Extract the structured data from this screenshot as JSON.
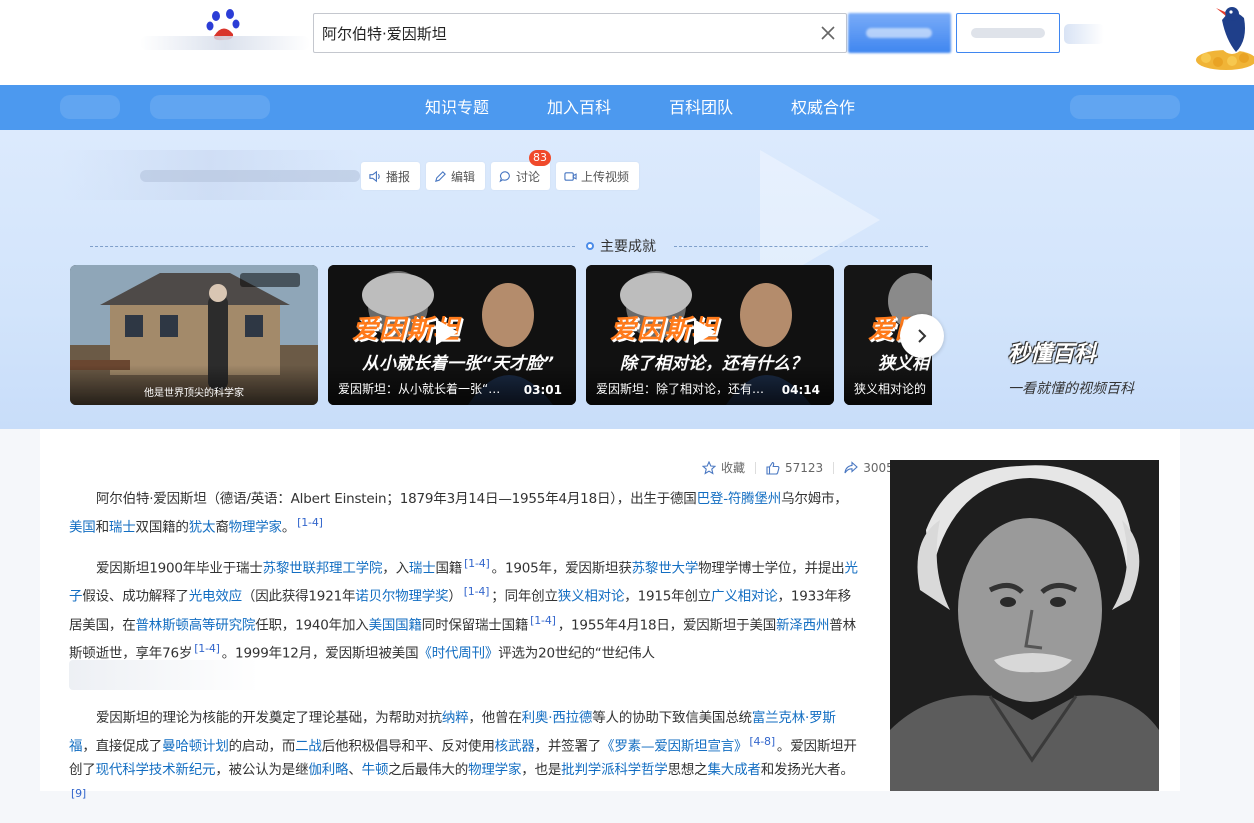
{
  "search": {
    "query": "阿尔伯特·爱因斯坦"
  },
  "nav": {
    "items": [
      "知识专题",
      "加入百科",
      "百科团队",
      "权威合作"
    ]
  },
  "actions": {
    "broadcast": "播报",
    "edit": "编辑",
    "discuss": "讨论",
    "discuss_count": "83",
    "upload": "上传视频"
  },
  "section": {
    "title": "主要成就"
  },
  "videos": [
    {
      "caption": "他是世界顶尖的科学家",
      "duration": "",
      "title": "",
      "subtitle": ""
    },
    {
      "caption": "爱因斯坦：从小就长着一张“天…",
      "duration": "03:01",
      "title": "爱因斯坦",
      "subtitle": "从小就长着一张“天才脸”"
    },
    {
      "caption": "爱因斯坦：除了相对论，还有什…",
      "duration": "04:14",
      "title": "爱因斯坦",
      "subtitle": "除了相对论，还有什么？"
    },
    {
      "caption": "狭义相对论的",
      "duration": "",
      "title": "爱因",
      "subtitle": "狭义相"
    }
  ],
  "brand": {
    "logo": "秒懂百科",
    "slogan": "一看就懂的视频百科"
  },
  "meta": {
    "collect": "收藏",
    "likes": "57123",
    "shares": "3005"
  },
  "colors": {
    "nav": "#4c99ef",
    "link": "#136ec2",
    "badge": "#f04a2b",
    "banner": "#d6e6fc"
  },
  "icons": [
    "search-clear-icon",
    "speaker-icon",
    "pencil-icon",
    "chat-icon",
    "video-icon",
    "chevron-right-icon",
    "star-icon",
    "thumb-up-icon",
    "share-icon"
  ],
  "article": {
    "p1": [
      {
        "t": "阿尔伯特·爱因斯坦（德语/英语：Albert Einstein；1879年3月14日—1955年4月18日），出生于德国"
      },
      {
        "a": "巴登-符腾堡州"
      },
      {
        "t": "乌尔姆市，"
      },
      {
        "a": "美国"
      },
      {
        "t": "和"
      },
      {
        "a": "瑞士"
      },
      {
        "t": "双国籍的"
      },
      {
        "a": "犹太"
      },
      {
        "t": "裔"
      },
      {
        "a": "物理学家"
      },
      {
        "t": "。"
      },
      {
        "s": "[1-4]"
      }
    ],
    "p2": [
      {
        "t": "爱因斯坦1900年毕业于瑞士"
      },
      {
        "a": "苏黎世联邦理工学院"
      },
      {
        "t": "，入"
      },
      {
        "a": "瑞士"
      },
      {
        "t": "国籍"
      },
      {
        "s": "[1-4]"
      },
      {
        "t": "。1905年，爱因斯坦获"
      },
      {
        "a": "苏黎世大学"
      },
      {
        "t": "物理学博士学位，并提出"
      },
      {
        "a": "光子"
      },
      {
        "t": "假设、成功解释了"
      },
      {
        "a": "光电效应"
      },
      {
        "t": "（因此获得1921年"
      },
      {
        "a": "诺贝尔物理学奖"
      },
      {
        "t": "）"
      },
      {
        "s": "[1-4]"
      },
      {
        "t": "；同年创立"
      },
      {
        "a": "狭义相对论"
      },
      {
        "t": "，1915年创立"
      },
      {
        "a": "广义相对论"
      },
      {
        "t": "，1933年移居美国，在"
      },
      {
        "a": "普林斯顿高等研究院"
      },
      {
        "t": "任职，1940年加入"
      },
      {
        "a": "美国国籍"
      },
      {
        "t": "同时保留瑞士国籍"
      },
      {
        "s": "[1-4]"
      },
      {
        "t": "，1955年4月18日，爱因斯坦于美国"
      },
      {
        "a": "新泽西州"
      },
      {
        "t": "普林斯顿逝世，享年76岁"
      },
      {
        "s": "[1-4]"
      },
      {
        "t": "。1999年12月，爱因斯坦被美国"
      },
      {
        "a": "《时代周刊》"
      },
      {
        "t": "评选为20世纪的“世纪伟人"
      }
    ],
    "p3": [
      {
        "t": "爱因斯坦的理论为核能的开发奠定了理论基础，为帮助对抗"
      },
      {
        "a": "纳粹"
      },
      {
        "t": "，他曾在"
      },
      {
        "a": "利奥·西拉德"
      },
      {
        "t": "等人的协助下致信美国总统"
      },
      {
        "a": "富兰克林·罗斯福"
      },
      {
        "t": "，直接促成了"
      },
      {
        "a": "曼哈顿计划"
      },
      {
        "t": "的启动，而"
      },
      {
        "a": "二战"
      },
      {
        "t": "后他积极倡导和平、反对使用"
      },
      {
        "a": "核武器"
      },
      {
        "t": "，并签署了"
      },
      {
        "a": "《罗素—爱因斯坦宣言》"
      },
      {
        "s": "[4-8]"
      },
      {
        "t": "。爱因斯坦开创了"
      },
      {
        "a": "现代科学技术新纪元"
      },
      {
        "t": "，被公认为是继"
      },
      {
        "a": "伽利略"
      },
      {
        "t": "、"
      },
      {
        "a": "牛顿"
      },
      {
        "t": "之后最伟大的"
      },
      {
        "a": "物理学家"
      },
      {
        "t": "，也是"
      },
      {
        "a": "批判学派科学哲学"
      },
      {
        "t": "思想之"
      },
      {
        "a": "集大成者"
      },
      {
        "t": "和发扬光大者。"
      },
      {
        "s": "[9]"
      }
    ]
  }
}
